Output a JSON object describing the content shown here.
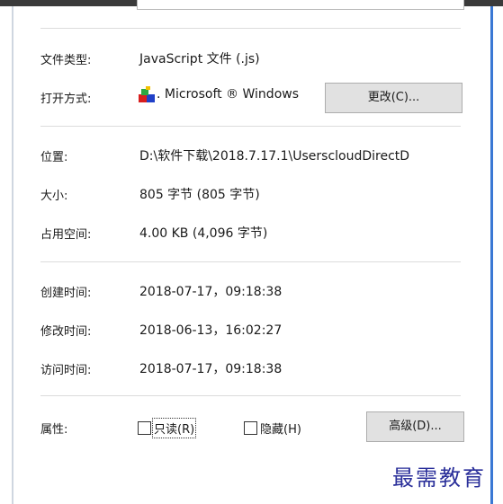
{
  "file_type": {
    "label": "文件类型:",
    "value": "JavaScript 文件 (.js)"
  },
  "opens_with": {
    "label": "打开方式:",
    "app_icon": "windows-script-host-icon",
    "app_name": ". Microsoft ® Windows",
    "change_button": "更改(C)..."
  },
  "location": {
    "label": "位置:",
    "value": "D:\\软件下载\\2018.7.17.1\\UserscloudDirectD"
  },
  "size": {
    "label": "大小:",
    "value": "805 字节 (805 字节)"
  },
  "size_on_disk": {
    "label": "占用空间:",
    "value": "4.00 KB (4,096 字节)"
  },
  "created": {
    "label": "创建时间:",
    "value": "2018-07-17，09:18:38"
  },
  "modified": {
    "label": "修改时间:",
    "value": "2018-06-13，16:02:27"
  },
  "accessed": {
    "label": "访问时间:",
    "value": "2018-07-17，09:18:38"
  },
  "attributes": {
    "label": "属性:",
    "readonly": "只读(R)",
    "hidden": "隐藏(H)",
    "advanced_button": "高级(D)..."
  },
  "watermark": "最需教育",
  "colors": {
    "accent_border": "#3a78d4",
    "button_bg": "#e1e1e1",
    "watermark": "#2a2f9a"
  }
}
